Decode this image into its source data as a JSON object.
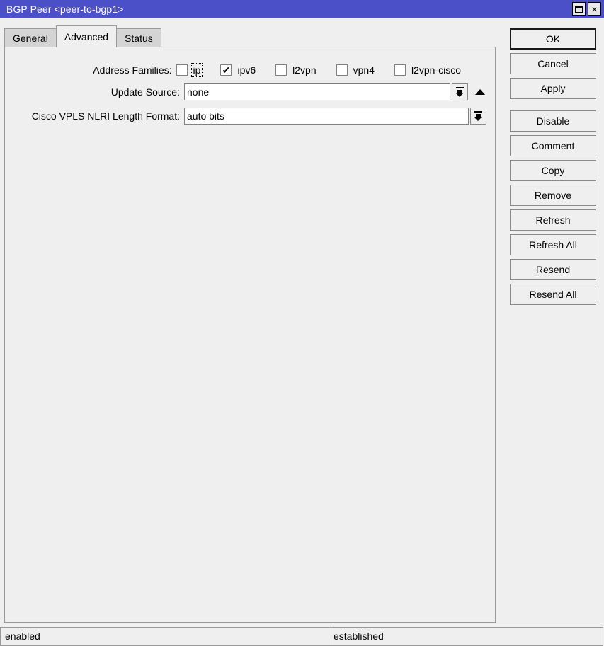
{
  "window": {
    "title": "BGP Peer <peer-to-bgp1>",
    "buttons": [
      {
        "name": "maximize-button",
        "icon": "maximize-icon",
        "label": ""
      },
      {
        "name": "close-button",
        "icon": "close-icon",
        "label": "×"
      }
    ]
  },
  "tabs": [
    {
      "label": "General",
      "active": false
    },
    {
      "label": "Advanced",
      "active": true
    },
    {
      "label": "Status",
      "active": false
    }
  ],
  "form": {
    "address_families": {
      "label": "Address Families:",
      "options": [
        {
          "label": "ip",
          "checked": false,
          "focused": true
        },
        {
          "label": "ipv6",
          "checked": true,
          "focused": false
        },
        {
          "label": "l2vpn",
          "checked": false,
          "focused": false
        },
        {
          "label": "vpn4",
          "checked": false,
          "focused": false
        },
        {
          "label": "l2vpn-cisco",
          "checked": false,
          "focused": false
        }
      ]
    },
    "update_source": {
      "label": "Update Source:",
      "value": "none",
      "dropdown_icon": "dropdown-arrow-icon",
      "expand_icon": "up-triangle-icon"
    },
    "cisco_vpls_nlri": {
      "label": "Cisco VPLS NLRI Length Format:",
      "value": "auto bits",
      "dropdown_icon": "dropdown-arrow-icon"
    }
  },
  "actions": [
    {
      "label": "OK",
      "name": "ok-button",
      "default": true,
      "gap": false
    },
    {
      "label": "Cancel",
      "name": "cancel-button",
      "default": false,
      "gap": false
    },
    {
      "label": "Apply",
      "name": "apply-button",
      "default": false,
      "gap": false
    },
    {
      "label": "Disable",
      "name": "disable-button",
      "default": false,
      "gap": true
    },
    {
      "label": "Comment",
      "name": "comment-button",
      "default": false,
      "gap": false
    },
    {
      "label": "Copy",
      "name": "copy-button",
      "default": false,
      "gap": false
    },
    {
      "label": "Remove",
      "name": "remove-button",
      "default": false,
      "gap": false
    },
    {
      "label": "Refresh",
      "name": "refresh-button",
      "default": false,
      "gap": false
    },
    {
      "label": "Refresh All",
      "name": "refresh-all-button",
      "default": false,
      "gap": false
    },
    {
      "label": "Resend",
      "name": "resend-button",
      "default": false,
      "gap": false
    },
    {
      "label": "Resend All",
      "name": "resend-all-button",
      "default": false,
      "gap": false
    }
  ],
  "statusbar": {
    "left": "enabled",
    "right": "established"
  },
  "colors": {
    "titlebar": "#4b4fc8",
    "face": "#efefef",
    "tab_inactive": "#d4d4d4",
    "border": "#9a9a9a"
  }
}
